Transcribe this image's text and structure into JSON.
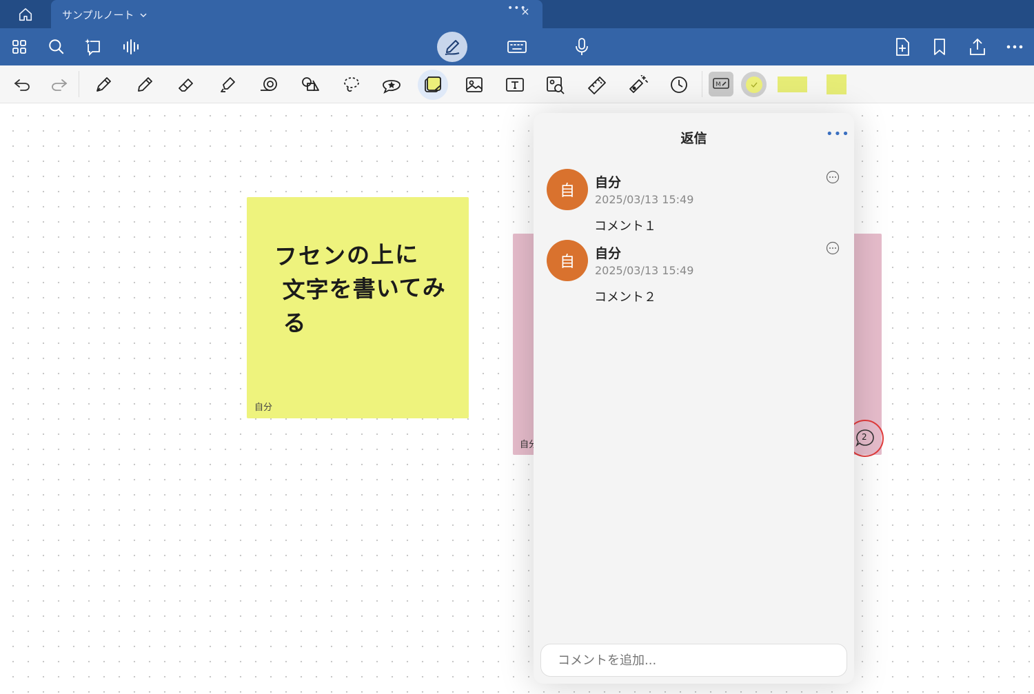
{
  "tab": {
    "title": "サンプルノート",
    "dots": "•••"
  },
  "toolbar": {
    "left_icons": [
      "grid-icon",
      "search-icon",
      "lasso-ai-icon",
      "audio-wave-icon"
    ],
    "center_icons": [
      "pen-mode-icon",
      "keyboard-icon",
      "microphone-icon"
    ],
    "right_icons": [
      "add-page-icon",
      "bookmark-icon",
      "share-icon",
      "more-icon"
    ]
  },
  "tools": [
    "undo-icon",
    "redo-icon",
    "fountain-pen-icon",
    "pencil-icon",
    "eraser-icon",
    "highlighter-icon",
    "tape-icon",
    "shapes-icon",
    "lasso-icon",
    "sticker-icon",
    "sticky-note-icon",
    "image-icon",
    "textbox-icon",
    "image-search-icon",
    "ruler-icon",
    "laser-pointer-icon",
    "clock-icon"
  ],
  "tool_options": {
    "mode_label": "M",
    "selected_color": "#ecef7a",
    "swatch_colors": [
      "#e6ec76",
      "#e6ec76"
    ]
  },
  "canvas": {
    "sticky_yellow": {
      "line1": "フセンの上に",
      "line2": "文字を書いてみる",
      "author": "自分",
      "color": "#eef37d"
    },
    "sticky_pink": {
      "author": "自分",
      "color": "#e6bccb"
    },
    "comment_badge_count": "2"
  },
  "reply_panel": {
    "title": "返信",
    "more": "•••",
    "comments": [
      {
        "avatar": "自",
        "author": "自分",
        "time": "2025/03/13 15:49",
        "text": "コメント１"
      },
      {
        "avatar": "自",
        "author": "自分",
        "time": "2025/03/13 15:49",
        "text": "コメント２"
      }
    ],
    "input_placeholder": "コメントを追加..."
  }
}
